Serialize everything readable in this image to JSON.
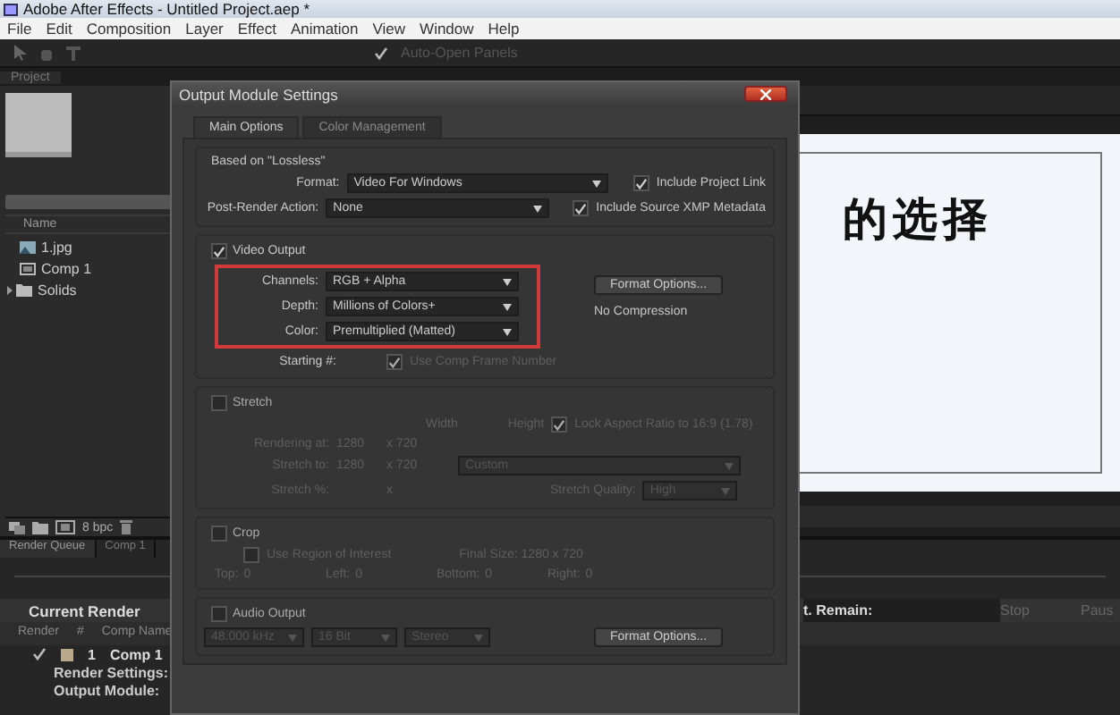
{
  "window": {
    "title": "Adobe After Effects - Untitled Project.aep *"
  },
  "menu": [
    "File",
    "Edit",
    "Composition",
    "Layer",
    "Effect",
    "Animation",
    "View",
    "Window",
    "Help"
  ],
  "toolbar": {
    "auto_open": {
      "label": "Auto-Open Panels",
      "checked": true
    }
  },
  "project_panel": {
    "tab": "Project",
    "column": "Name",
    "items": [
      {
        "name": "1.jpg",
        "kind": "image"
      },
      {
        "name": "Comp 1",
        "kind": "comp"
      },
      {
        "name": "Solids",
        "kind": "folder"
      }
    ],
    "bit_depth": "8 bpc"
  },
  "viewer": {
    "text": "的选择"
  },
  "render_queue": {
    "tabs": [
      {
        "label": "Render Queue",
        "selected": true
      },
      {
        "label": "Comp 1",
        "selected": false
      }
    ],
    "current_render": "Current Render",
    "remain": "t. Remain:",
    "buttons": [
      "Stop",
      "Paus"
    ],
    "columns": [
      "Render",
      "#",
      "Comp Name"
    ],
    "item": {
      "render": true,
      "number": "1",
      "comp": "Comp 1"
    },
    "settings": [
      "Render Settings:",
      "Output Module:"
    ]
  },
  "dialog": {
    "title": "Output Module Settings",
    "tabs": [
      {
        "label": "Main Options",
        "selected": true
      },
      {
        "label": "Color Management",
        "selected": false
      }
    ],
    "based_on": {
      "title": "Based on \"Lossless\"",
      "rows": [
        {
          "label": "Format:",
          "value": "Video For Windows",
          "check": {
            "label": "Include Project Link",
            "checked": true
          }
        },
        {
          "label": "Post-Render Action:",
          "value": "None",
          "check": {
            "label": "Include Source XMP Metadata",
            "checked": true
          }
        }
      ]
    },
    "video_output": {
      "label": "Video Output",
      "checked": true,
      "highlighted": true,
      "fields": [
        {
          "label": "Channels:",
          "value": "RGB + Alpha"
        },
        {
          "label": "Depth:",
          "value": "Millions of Colors+"
        },
        {
          "label": "Color:",
          "value": "Premultiplied (Matted)"
        }
      ],
      "format_options": "Format Options...",
      "compression": "No Compression",
      "starting_label": "Starting #:",
      "use_comp_frame": {
        "label": "Use Comp Frame Number",
        "checked": true
      }
    },
    "stretch": {
      "label": "Stretch",
      "checked": false,
      "width_label": "Width",
      "height_label": "Height",
      "lock": {
        "label": "Lock Aspect Ratio to 16:9 (1.78)",
        "checked": true
      },
      "rendering_label": "Rendering at:",
      "rendering_w": "1280",
      "rendering_h": "x 720",
      "stretch_to_label": "Stretch to:",
      "stretch_w": "1280",
      "stretch_h": "x 720",
      "preset": "Custom",
      "percent_label": "Stretch %:",
      "percent_x": "x",
      "quality_label": "Stretch Quality:",
      "quality": "High"
    },
    "crop": {
      "label": "Crop",
      "checked": false,
      "roi": {
        "label": "Use Region of Interest",
        "checked": false
      },
      "final_size": "Final Size: 1280 x 720",
      "margins": [
        {
          "label": "Top:",
          "value": "0"
        },
        {
          "label": "Left:",
          "value": "0"
        },
        {
          "label": "Bottom:",
          "value": "0"
        },
        {
          "label": "Right:",
          "value": "0"
        }
      ]
    },
    "audio": {
      "label": "Audio Output",
      "checked": false,
      "rate": "48.000 kHz",
      "bits": "16 Bit",
      "channels": "Stereo",
      "format_options": "Format Options..."
    }
  }
}
